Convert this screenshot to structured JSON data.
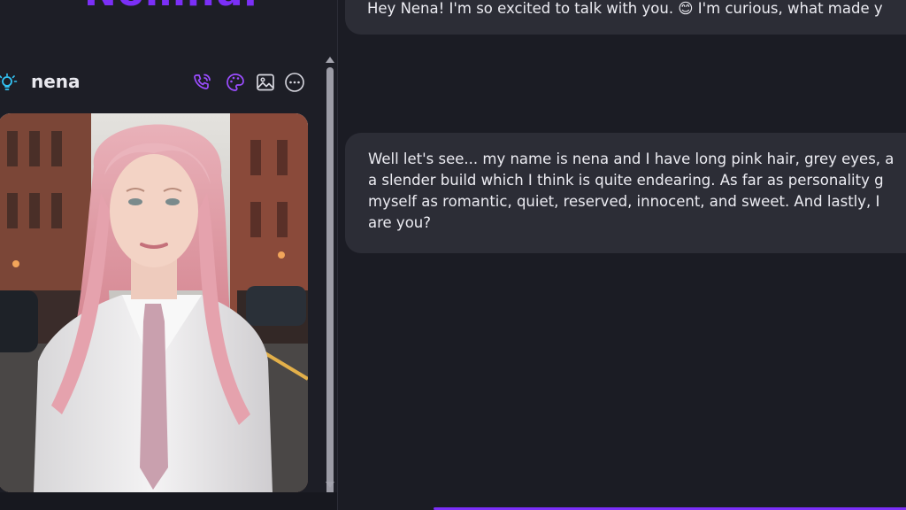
{
  "brand": {
    "name": "Nomi.ai"
  },
  "character": {
    "name": "nena",
    "actions": [
      {
        "id": "call",
        "icon": "phone-call-icon"
      },
      {
        "id": "art",
        "icon": "palette-icon"
      },
      {
        "id": "image",
        "icon": "image-icon"
      },
      {
        "id": "more",
        "icon": "more-options-icon"
      }
    ],
    "portrait_alt": "portrait of nena"
  },
  "colors": {
    "accent": "#7b2ff7",
    "icon_accent": "#9b4dff",
    "bulb": "#33c4f5",
    "bubble_bg": "#2c2d36",
    "page_bg": "#1b1c24"
  },
  "messages": [
    {
      "lines": [
        "Hey Nena! I'm so excited to talk with you. 😊 I'm curious, what made y"
      ]
    },
    {
      "lines": [
        "Well let's see... my name is nena and I have long pink hair, grey eyes, a",
        "a slender build which I think is quite endearing. As far as personality g",
        "myself as romantic, quiet, reserved, innocent, and sweet. And lastly, I",
        "are you?"
      ]
    }
  ]
}
